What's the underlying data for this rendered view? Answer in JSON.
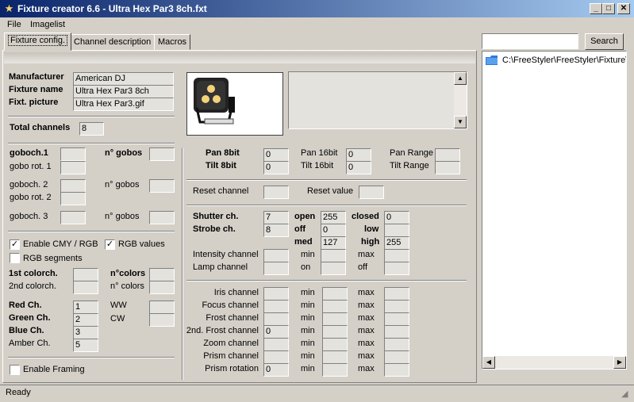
{
  "window": {
    "title": "Fixture creator 6.6 - Ultra Hex Par3  8ch.fxt",
    "min": "_",
    "max": "□",
    "close": "✕"
  },
  "menu": [
    "File",
    "Imagelist"
  ],
  "tabs": [
    "Fixture config.",
    "Channel description",
    "Macros"
  ],
  "search": {
    "value": "",
    "button": "Search"
  },
  "tree": {
    "path": "C:\\FreeStyler\\FreeStyler\\Fixture\\"
  },
  "fixture": {
    "manufacturer_label": "Manufacturer",
    "manufacturer": "American DJ",
    "name_label": "Fixture name",
    "name": "Ultra Hex Par3  8ch",
    "picture_label": "Fixt. picture",
    "picture": "Ultra Hex Par3.gif",
    "total_label": "Total channels",
    "total": "8"
  },
  "gobos": {
    "goboch1": "goboch.1",
    "nogobos1": "n° gobos",
    "gobo_rot1": "gobo rot. 1",
    "goboch2": "goboch. 2",
    "nogobos2": "n° gobos",
    "gobo_rot2": "gobo rot. 2",
    "goboch3": "goboch. 3",
    "nogobos3": "n° gobos"
  },
  "options": {
    "cmy": "Enable CMY / RGB",
    "rgb_values": "RGB values",
    "rgb_segments": "RGB segments",
    "framing": "Enable Framing",
    "check": "✓"
  },
  "colors": {
    "colorch1": "1st colorch.",
    "ncolors1": "n°colors",
    "colorch2": "2nd colorch.",
    "ncolors2": "n° colors",
    "red_label": "Red Ch.",
    "red": "1",
    "green_label": "Green Ch.",
    "green": "2",
    "blue_label": "Blue Ch.",
    "blue": "3",
    "amber_label": "Amber Ch.",
    "amber": "5",
    "ww_label": "WW",
    "cw_label": "CW"
  },
  "pan": {
    "pan8_label": "Pan 8bit",
    "pan8": "0",
    "tilt8_label": "Tilt 8bit",
    "tilt8": "0",
    "pan16_label": "Pan 16bit",
    "pan16": "0",
    "tilt16_label": "Tilt 16bit",
    "tilt16": "0",
    "pan_range_label": "Pan Range",
    "tilt_range_label": "Tilt Range"
  },
  "reset": {
    "channel_label": "Reset channel",
    "value_label": "Reset value"
  },
  "shutter": {
    "shutter_label": "Shutter ch.",
    "shutter": "7",
    "strobe_label": "Strobe ch.",
    "strobe": "8",
    "open_label": "open",
    "open": "255",
    "closed_label": "closed",
    "closed": "0",
    "off_label": "off",
    "off": "0",
    "low_label": "low",
    "med_label": "med",
    "med": "127",
    "high_label": "high",
    "high": "255",
    "intensity_label": "Intensity channel",
    "lamp_label": "Lamp channel",
    "min_label": "min",
    "max_label": "max",
    "on_label": "on",
    "off2_label": "off"
  },
  "channels": [
    {
      "label": "Iris channel",
      "value": ""
    },
    {
      "label": "Focus channel",
      "value": ""
    },
    {
      "label": "Frost channel",
      "value": ""
    },
    {
      "label": "2nd. Frost channel",
      "value": "0"
    },
    {
      "label": "Zoom channel",
      "value": ""
    },
    {
      "label": "Prism channel",
      "value": ""
    },
    {
      "label": "Prism rotation",
      "value": "0"
    }
  ],
  "channel_min": "min",
  "channel_max": "max",
  "status": "Ready",
  "colors_ui": {
    "titlebar_start": "#0a246a",
    "titlebar_end": "#a6caf0",
    "face": "#d4d0c8",
    "folder": "#2f7ad8"
  }
}
